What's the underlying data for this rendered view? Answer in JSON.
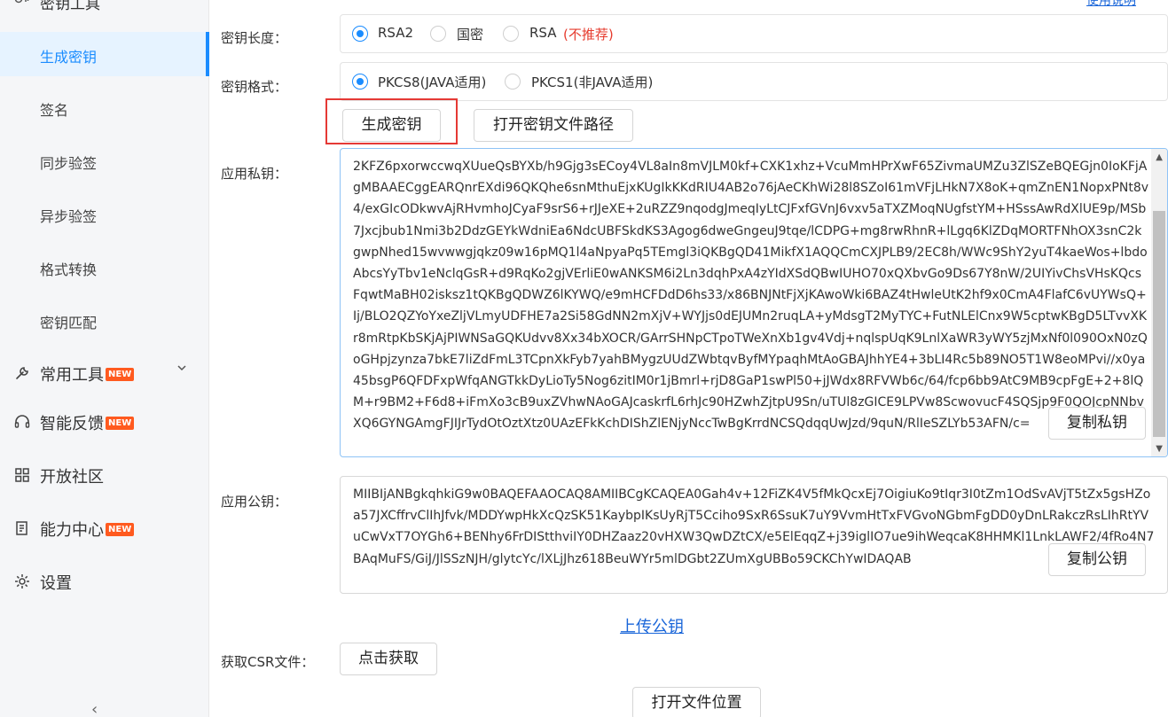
{
  "sidebar": {
    "top_group": {
      "label": "密钥工具"
    },
    "sub_items": [
      {
        "label": "生成密钥"
      },
      {
        "label": "签名"
      },
      {
        "label": "同步验签"
      },
      {
        "label": "异步验签"
      },
      {
        "label": "格式转换"
      },
      {
        "label": "密钥匹配"
      }
    ],
    "menu_items": [
      {
        "label": "常用工具",
        "badge": "NEW"
      },
      {
        "label": "智能反馈",
        "badge": "NEW"
      },
      {
        "label": "开放社区"
      },
      {
        "label": "能力中心",
        "badge": "NEW"
      },
      {
        "label": "设置"
      }
    ],
    "collapse_glyph": "‹"
  },
  "main": {
    "top_link": "使用说明",
    "key_length": {
      "label": "密钥长度：",
      "options": [
        "RSA2",
        "国密",
        "RSA"
      ],
      "selected": "RSA2",
      "warning": "(不推荐)"
    },
    "key_format": {
      "label": "密钥格式：",
      "options": [
        "PKCS8(JAVA适用)",
        "PKCS1(非JAVA适用)"
      ],
      "selected": "PKCS8(JAVA适用)"
    },
    "generate_button": "生成密钥",
    "open_path_button": "打开密钥文件路径",
    "private_key": {
      "label": "应用私钥：",
      "value": "2KFZ6pxorwccwqXUueQsBYXb/h9Gjg3sECoy4VL8aIn8mVJLM0kf+CXK1xhz+VcuMmHPrXwF65ZivmaUMZu3ZlSZeBQEGjn0IoKFjAgMBAAECggEARQnrEXdi96QKQhe6snMthuEjxKUgIkKKdRIU4AB2o76jAeCKhWi28l8SZoI61mVFjLHkN7X8oK+qmZnEN1NopxPNt8v4/exGIcODkwvAjRHvmhoJCyaF9srS6+rJJeXE+2uRZZ9nqodgJmeqIyLtCJFxfGVnJ6vxv5aTXZMoqNUgfstYM+HSssAwRdXlUE9p/MSb7Jxcjbub1Nmi3b2DdzGEYkWdniEa6NdcUBFSkdKS3Agog6dweGngeuJ9tqe/lCDPG+mg8rwRhnR+lLgq6KlZDqMORTFNhOX3snC2kgwpNhed15wvwwgjqkz09w16pMQ1l4aNpyaPq5TEmgl3iQKBgQD41MikfX1AQQCmCXJPLB9/2EC8h/WWc9ShY2yuT4kaeWos+lbdoAbcsYyTbv1eNclqGsR+d9RqKo2gjVErliE0wANKSM6i2Ln3dqhPxA4zYIdXSdQBwIUHO70xQXbvGo9Ds67Y8nW/2UIYivChsVHsKQcsFqwtMaBH02isksz1tQKBgQDWZ6lKYWQ/e9mHCFDdD6hs33/x86BNJNtFjXjKAwoWki6BAZ4tHwleUtK2hf9x0CmA4FlafC6vUYWsQ+Ij/BLO2QZYoYxeZljVLmyUDFHE7a2Si58GdNN2mXjV+WYJjs0dEJUMn2ruqLA+yMdsgT2MyTYC+FutNLElCnx9W5cptwKBgD5LTvvXKr8mRtpKbSKjAjPIWNSaGQKUdvv8Xx34bXOCR/GArrSHNpCTpoTWeXnXb1gv4Vdj+nqlspUqK9LnlXaWR3yWY5zjMxNf0l090OxN0zQoGHpjzynza7bkE7liZdFmL3TCpnXkFyb7yahBMygzUUdZWbtqvByfMYpaqhMtAoGBAJhhYE4+3bLI4Rc5b89NO5T1W8eoMPvi//x0ya45bsgP6QFDFxpWfqANGTkkDyLioTy5Nog6zitIM0r1jBmrl+rjD8GaP1swPl50+jJWdx8RFVWb6c/64/fcp6bb9AtC9MB9cpFgE+2+8lQM+r9BM2+F6d8+iFmXo3cB9uxZVhwNAoGAJcaskrfL6rhJc90HZwhZjtpU9Sn/uTUl8zGICE9LPVw8ScwovucF4SQSjp9F0QOJcpNNbvXQ6GYNGAmgFJIJrTydOtOztXtz0UAzEFkKchDIShZlENjyNccTwBgKrrdNCSQdqqUwJzd/9quN/RlIeSZLYb53AFN/c=",
      "copy_button": "复制私钥"
    },
    "public_key": {
      "label": "应用公钥：",
      "value": "MIIBIjANBgkqhkiG9w0BAQEFAAOCAQ8AMIIBCgKCAQEA0Gah4v+12FiZK4V5fMkQcxEj7OigiuKo9tIqr3I0tZm1OdSvAVjT5tZx5gsHZoa57JXCffrvClIhJfvk/MDDYwpHkXcQzSK51KaybpIKsUyRjT5Cciho9SxR6SsuK7uY9VvmHtTxFVGvoNGbmFgDD0yDnLRakczRsLIhRtYVuCwVxT7OYGh6+BENhy6FrDIStthviIY0DHZaaz20vHXW3QwDZtCX/e5ElEqqZ+j39iglIO7ue9ihWeqcaK8HHMKl1LnkLAWF2/4fRo4N7BAqMuFS/GiJ/JlSSzNJH/glytcYc/lXLjJhz618BeuWYr5mlDGbt2ZUmXgUBBo59CKChYwIDAQAB",
      "copy_button": "复制公钥"
    },
    "upload_link": "上传公钥",
    "csr": {
      "label": "获取CSR文件：",
      "button": "点击获取"
    },
    "open_file_button": "打开文件位置"
  },
  "colors": {
    "accent": "#1a8cff",
    "warning": "#e63b2e",
    "badge": "#ff5a1f",
    "highlight": "#e53935"
  }
}
